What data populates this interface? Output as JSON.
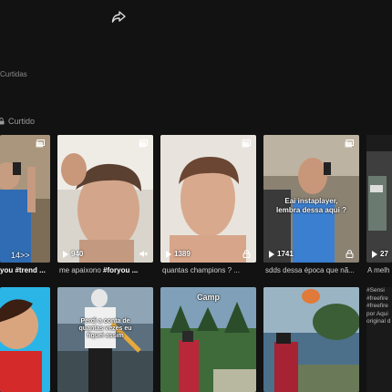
{
  "header": {
    "share_icon": "share-arrow-icon"
  },
  "tabs": {
    "liked_label": "Curtidas"
  },
  "section": {
    "title": "Curtido",
    "icon": "lock-icon"
  },
  "videos": [
    {
      "views": "14>>",
      "caption_tag": "you #trend ...",
      "caption": "",
      "overlay": "",
      "icon": "multi-photo-icon"
    },
    {
      "views": "940",
      "caption": "me apaixono ",
      "caption_tag": "#foryou ...",
      "overlay": "",
      "icon": "muted-speaker-icon"
    },
    {
      "views": "1389",
      "caption": "quantas champions ? ...",
      "caption_tag": "",
      "overlay": "",
      "icon": "lock-icon"
    },
    {
      "views": "1741",
      "caption": "sdds dessa época que nã...",
      "caption_tag": "",
      "overlay": "Eai instaplayer, lembra dessa aqui ?",
      "icon": "lock-icon"
    },
    {
      "views": "27",
      "caption": "A melh",
      "caption_tag": "",
      "overlay": "",
      "icon": ""
    }
  ],
  "bottom_row": [
    {
      "overlay": ""
    },
    {
      "overlay": "Perdi a conta de quantas vezes eu fiquei assim"
    },
    {
      "overlay": "Camp"
    },
    {
      "overlay": ""
    }
  ],
  "side_caption": "#Sensi #freefire #freefire por Aqui original d"
}
